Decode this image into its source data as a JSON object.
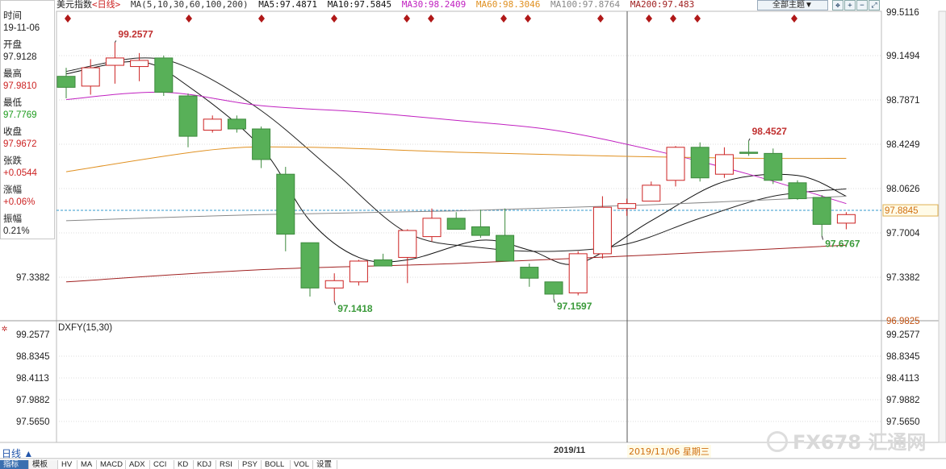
{
  "info": {
    "time_label": "时间",
    "time_value": "19-11-06",
    "open_label": "开盘",
    "open_value": "97.9128",
    "high_label": "最高",
    "high_value": "97.9810",
    "low_label": "最低",
    "low_value": "97.7769",
    "close_label": "收盘",
    "close_value": "97.9672",
    "change_label": "张跌",
    "change_value": "+0.0544",
    "pct_label": "涨幅",
    "pct_value": "+0.06%",
    "amp_label": "振幅",
    "amp_value": "0.21%"
  },
  "header": {
    "symbol": "美元指数",
    "period": "<日线>",
    "ma_params": "MA(5,10,30,60,100,200)",
    "ma5": "MA5:97.4871",
    "ma10": "MA10:97.5845",
    "ma30": "MA30:98.2409",
    "ma60": "MA60:98.3046",
    "ma100": "MA100:97.8764",
    "ma200": "MA200:97.483",
    "theme_select": "全部主题▼"
  },
  "colors": {
    "up": "#cc2222",
    "down": "#58b058",
    "ma5": "#111111",
    "ma10": "#222222",
    "ma30": "#c020c0",
    "ma60": "#e09020",
    "ma100": "#888888",
    "ma200": "#a02020",
    "grid": "#dddddd",
    "crosshair": "#555555",
    "dash": "#3399cc"
  },
  "price_axis": {
    "labels": [
      "99.5116",
      "99.1494",
      "98.7871",
      "98.4249",
      "98.0626",
      "97.7004",
      "97.3382",
      "96.9825"
    ],
    "left_label": "97.3382",
    "current_value": "97.8845"
  },
  "annotations": {
    "high": "99.2577",
    "low1": "97.1418",
    "low2": "97.1597",
    "peak": "98.4527",
    "recent_low": "97.6767"
  },
  "lower_panel": {
    "title": "DXFY(15,30)",
    "labels": [
      "99.2577",
      "98.8345",
      "98.4113",
      "97.9882",
      "97.5650"
    ],
    "left_labels": [
      "99.2577",
      "98.8345",
      "98.4113",
      "97.9882",
      "97.5650"
    ]
  },
  "footer": {
    "period_label": "日线 ▲",
    "date_label": "2019/11",
    "cursor_date": "2019/11/06 星期三",
    "watermark": "FX678 汇通网"
  },
  "tabs": [
    "指标",
    "模板",
    "HV",
    "MA",
    "MACD",
    "ADX",
    "CCI",
    "KD",
    "KDJ",
    "RSI",
    "PSY",
    "BOLL",
    "VOL",
    "设置"
  ],
  "chart_data": {
    "type": "candlestick",
    "price_range": [
      96.9825,
      99.5116
    ],
    "candles": [
      {
        "o": 98.98,
        "h": 99.05,
        "l": 98.8,
        "c": 98.89
      },
      {
        "o": 98.9,
        "h": 99.12,
        "l": 98.83,
        "c": 99.05
      },
      {
        "o": 99.07,
        "h": 99.2577,
        "l": 98.92,
        "c": 99.13
      },
      {
        "o": 99.06,
        "h": 99.17,
        "l": 98.94,
        "c": 99.11
      },
      {
        "o": 99.13,
        "h": 99.15,
        "l": 98.82,
        "c": 98.85
      },
      {
        "o": 98.82,
        "h": 98.84,
        "l": 98.4,
        "c": 98.49
      },
      {
        "o": 98.54,
        "h": 98.66,
        "l": 98.52,
        "c": 98.63
      },
      {
        "o": 98.63,
        "h": 98.66,
        "l": 98.52,
        "c": 98.55
      },
      {
        "o": 98.55,
        "h": 98.57,
        "l": 98.23,
        "c": 98.3
      },
      {
        "o": 98.18,
        "h": 98.24,
        "l": 97.55,
        "c": 97.69
      },
      {
        "o": 97.62,
        "h": 97.62,
        "l": 97.18,
        "c": 97.25
      },
      {
        "o": 97.25,
        "h": 97.37,
        "l": 97.1418,
        "c": 97.31
      },
      {
        "o": 97.3,
        "h": 97.48,
        "l": 97.27,
        "c": 97.47
      },
      {
        "o": 97.48,
        "h": 97.53,
        "l": 97.46,
        "c": 97.43
      },
      {
        "o": 97.5,
        "h": 97.73,
        "l": 97.29,
        "c": 97.72
      },
      {
        "o": 97.67,
        "h": 97.9,
        "l": 97.63,
        "c": 97.82
      },
      {
        "o": 97.82,
        "h": 97.87,
        "l": 97.73,
        "c": 97.73
      },
      {
        "o": 97.75,
        "h": 97.89,
        "l": 97.66,
        "c": 97.68
      },
      {
        "o": 97.68,
        "h": 97.9,
        "l": 97.47,
        "c": 97.47
      },
      {
        "o": 97.42,
        "h": 97.45,
        "l": 97.26,
        "c": 97.33
      },
      {
        "o": 97.3,
        "h": 97.3,
        "l": 97.1597,
        "c": 97.2
      },
      {
        "o": 97.21,
        "h": 97.55,
        "l": 97.19,
        "c": 97.53
      },
      {
        "o": 97.53,
        "h": 98.0,
        "l": 97.49,
        "c": 97.91
      },
      {
        "o": 97.9,
        "h": 97.98,
        "l": 97.84,
        "c": 97.94
      },
      {
        "o": 97.96,
        "h": 98.12,
        "l": 97.96,
        "c": 98.09
      },
      {
        "o": 98.13,
        "h": 98.41,
        "l": 98.08,
        "c": 98.4
      },
      {
        "o": 98.4,
        "h": 98.44,
        "l": 98.12,
        "c": 98.15
      },
      {
        "o": 98.18,
        "h": 98.4,
        "l": 98.15,
        "c": 98.34
      },
      {
        "o": 98.36,
        "h": 98.4527,
        "l": 98.33,
        "c": 98.35
      },
      {
        "o": 98.35,
        "h": 98.39,
        "l": 98.1,
        "c": 98.13
      },
      {
        "o": 98.11,
        "h": 98.13,
        "l": 97.97,
        "c": 97.98
      },
      {
        "o": 97.99,
        "h": 98.01,
        "l": 97.6767,
        "c": 97.77
      },
      {
        "o": 97.78,
        "h": 97.87,
        "l": 97.73,
        "c": 97.85
      }
    ],
    "ma": {
      "ma5": [
        [
          0,
          99.0
        ],
        [
          3,
          99.1
        ],
        [
          5,
          98.9
        ],
        [
          8,
          98.4
        ],
        [
          10,
          97.8
        ],
        [
          12,
          97.5
        ],
        [
          14,
          97.48
        ],
        [
          17,
          97.64
        ],
        [
          19,
          97.56
        ],
        [
          21,
          97.45
        ],
        [
          24,
          97.8
        ],
        [
          27,
          98.12
        ],
        [
          30,
          98.17
        ],
        [
          32,
          98.0
        ]
      ],
      "ma10": [
        [
          0,
          99.02
        ],
        [
          3,
          99.13
        ],
        [
          5,
          99.05
        ],
        [
          8,
          98.7
        ],
        [
          11,
          98.2
        ],
        [
          14,
          97.7
        ],
        [
          17,
          97.58
        ],
        [
          20,
          97.55
        ],
        [
          23,
          97.61
        ],
        [
          26,
          97.82
        ],
        [
          29,
          98.0
        ],
        [
          32,
          98.06
        ]
      ],
      "ma30": [
        [
          0,
          98.79
        ],
        [
          4,
          98.85
        ],
        [
          8,
          98.74
        ],
        [
          12,
          98.69
        ],
        [
          16,
          98.62
        ],
        [
          20,
          98.54
        ],
        [
          24,
          98.38
        ],
        [
          28,
          98.18
        ],
        [
          32,
          97.94
        ]
      ],
      "ma60": [
        [
          0,
          98.2
        ],
        [
          6,
          98.38
        ],
        [
          10,
          98.4
        ],
        [
          16,
          98.36
        ],
        [
          22,
          98.33
        ],
        [
          28,
          98.31
        ],
        [
          32,
          98.31
        ]
      ],
      "ma100": [
        [
          0,
          97.8
        ],
        [
          8,
          97.85
        ],
        [
          16,
          97.88
        ],
        [
          24,
          97.93
        ],
        [
          32,
          98.0
        ]
      ],
      "ma200": [
        [
          0,
          97.3
        ],
        [
          8,
          97.4
        ],
        [
          16,
          97.45
        ],
        [
          24,
          97.52
        ],
        [
          32,
          97.6
        ]
      ]
    }
  }
}
